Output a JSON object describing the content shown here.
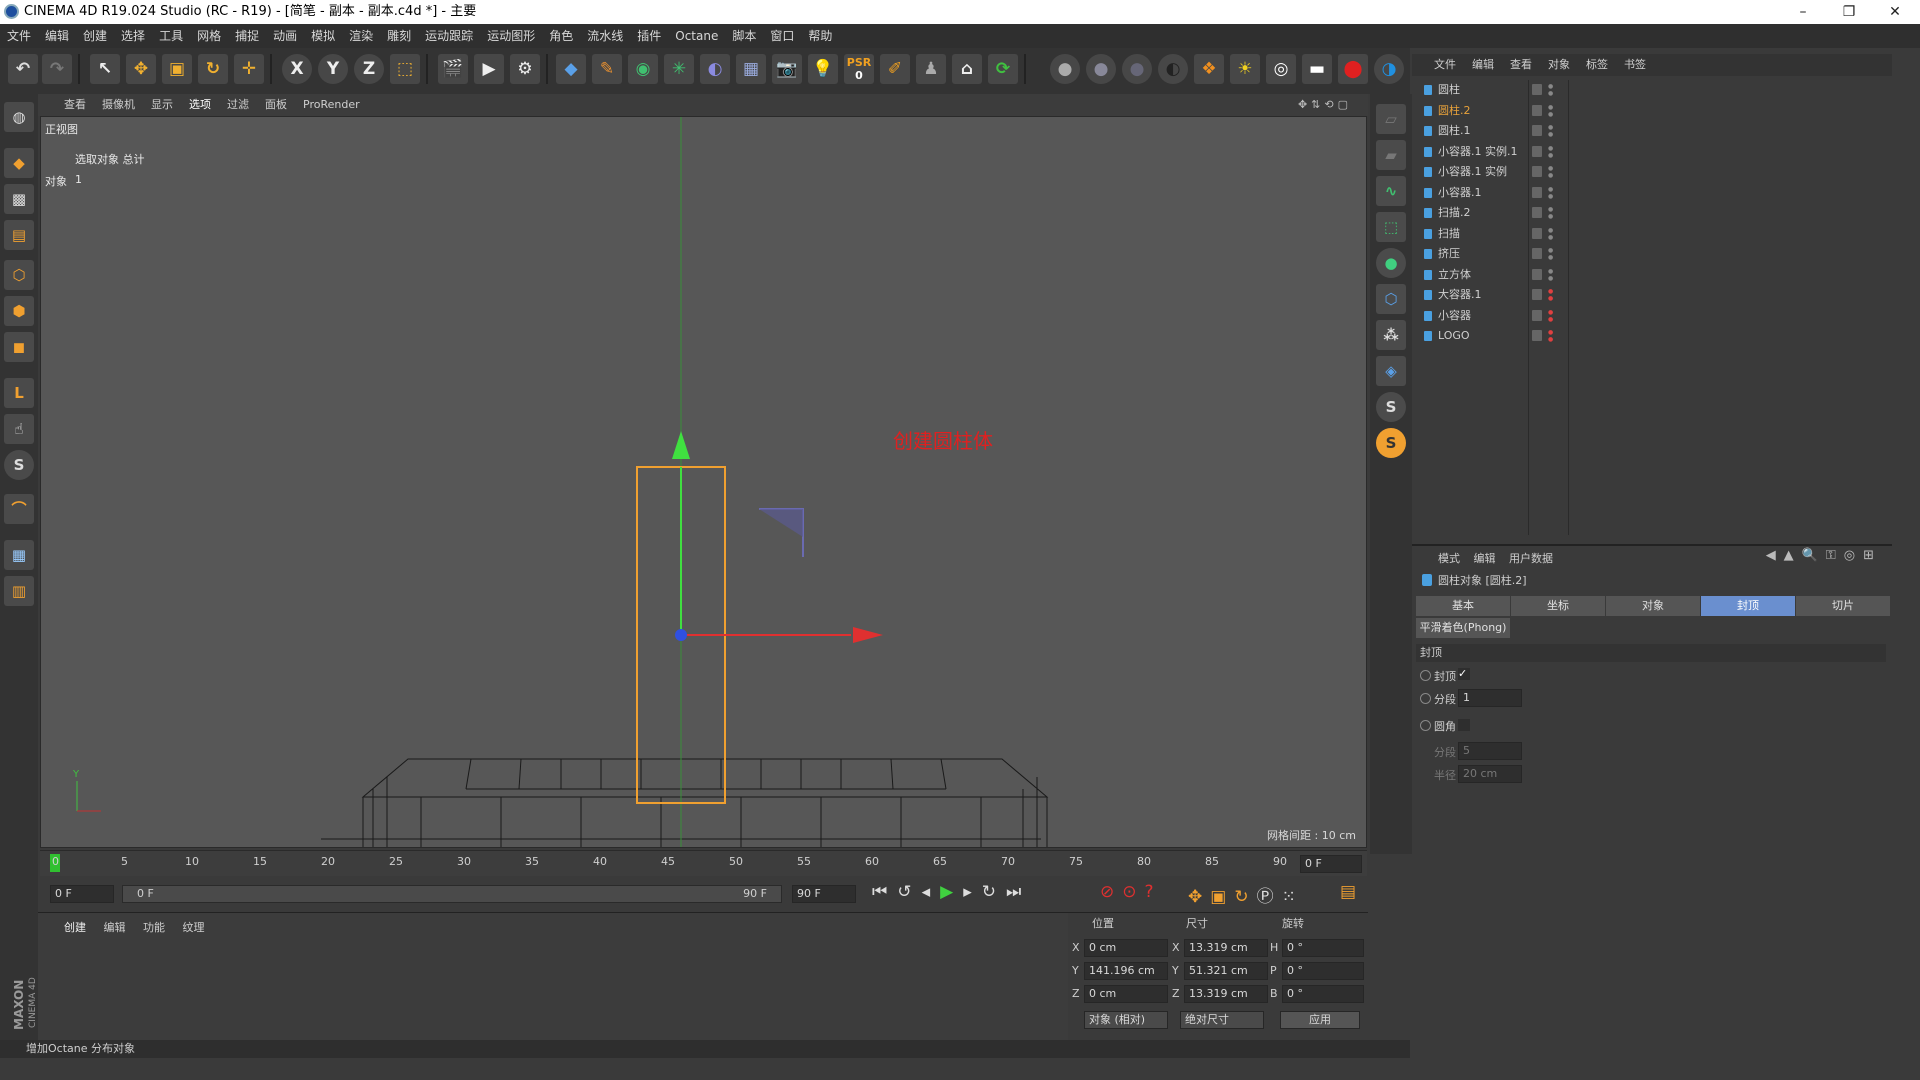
{
  "window": {
    "title": "CINEMA 4D R19.024 Studio (RC - R19) - [简笔 - 副本 - 副本.c4d *] - 主要"
  },
  "menu": [
    "文件",
    "编辑",
    "创建",
    "选择",
    "工具",
    "网格",
    "捕捉",
    "动画",
    "模拟",
    "渲染",
    "雕刻",
    "运动跟踪",
    "运动图形",
    "角色",
    "流水线",
    "插件",
    "Octane",
    "脚本",
    "窗口",
    "帮助"
  ],
  "toolbar": {
    "psr_label": "PSR",
    "psr_value": "0"
  },
  "viewport": {
    "menu": [
      "查看",
      "摄像机",
      "显示",
      "选项",
      "过滤",
      "面板",
      "ProRender"
    ],
    "name": "正视图",
    "hud_line1": "选取对象 总计",
    "hud_obj_label": "对象",
    "hud_obj_count": "1",
    "annotation": "创建圆柱体",
    "grid_info": "网格间距 : 10 cm"
  },
  "timeline": {
    "ticks": [
      "0",
      "5",
      "10",
      "15",
      "20",
      "25",
      "30",
      "35",
      "40",
      "45",
      "50",
      "55",
      "60",
      "65",
      "70",
      "75",
      "80",
      "85",
      "90"
    ],
    "current_frame": "0 F",
    "start_field": "0 F",
    "range_start": "0 F",
    "range_end": "90 F",
    "end_field": "90 F"
  },
  "material_manager": {
    "tabs": [
      "创建",
      "编辑",
      "功能",
      "纹理"
    ]
  },
  "coordinates": {
    "headers": {
      "position": "位置",
      "size": "尺寸",
      "rotation": "旋转"
    },
    "rows": [
      {
        "axis": "X",
        "pos": "0 cm",
        "size_axis": "X",
        "size": "13.319 cm",
        "rot_axis": "H",
        "rot": "0 °"
      },
      {
        "axis": "Y",
        "pos": "141.196 cm",
        "size_axis": "Y",
        "size": "51.321 cm",
        "rot_axis": "P",
        "rot": "0 °"
      },
      {
        "axis": "Z",
        "pos": "0 cm",
        "size_axis": "Z",
        "size": "13.319 cm",
        "rot_axis": "B",
        "rot": "0 °"
      }
    ],
    "mode_select": "对象 (相对)",
    "size_select": "绝对尺寸",
    "apply_button": "应用"
  },
  "status": {
    "text": "增加Octane 分布对象"
  },
  "brand": {
    "vendor": "MAXON",
    "product": "CINEMA 4D"
  },
  "object_manager": {
    "tabs": [
      "文件",
      "编辑",
      "查看",
      "对象",
      "标签",
      "书签"
    ],
    "objects": [
      {
        "name": "圆柱",
        "color": "#d0d0d0"
      },
      {
        "name": "圆柱.2",
        "color": "#e8a23a"
      },
      {
        "name": "圆柱.1",
        "color": "#d0d0d0"
      },
      {
        "name": "小容器.1 实例.1",
        "color": "#d0d0d0"
      },
      {
        "name": "小容器.1 实例",
        "color": "#d0d0d0"
      },
      {
        "name": "小容器.1",
        "color": "#d0d0d0"
      },
      {
        "name": "扫描.2",
        "color": "#d0d0d0"
      },
      {
        "name": "扫描",
        "color": "#d0d0d0"
      },
      {
        "name": "挤压",
        "color": "#d0d0d0"
      },
      {
        "name": "立方体",
        "color": "#d0d0d0"
      },
      {
        "name": "大容器.1",
        "color": "#d0d0d0"
      },
      {
        "name": "小容器",
        "color": "#d0d0d0"
      },
      {
        "name": "LOGO",
        "color": "#d0d0d0"
      }
    ]
  },
  "attributes": {
    "menu": [
      "模式",
      "编辑",
      "用户数据"
    ],
    "object_title": "圆柱对象 [圆柱.2]",
    "tabs": [
      "基本",
      "坐标",
      "对象",
      "封顶",
      "切片"
    ],
    "active_tab": "封顶",
    "phong_tab": "平滑着色(Phong)",
    "section": "封顶",
    "cap_label": "封顶",
    "cap_check": "✓",
    "segments_label": "分段",
    "segments_value": "1",
    "fillet_label": "圆角",
    "fillet_segments_label": "分段",
    "fillet_segments_value": "5",
    "radius_label": "半径",
    "radius_value": "20 cm"
  }
}
